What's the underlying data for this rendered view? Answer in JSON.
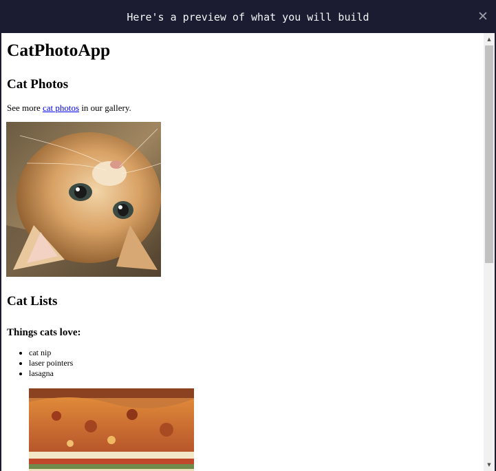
{
  "modal": {
    "title": "Here's a preview of what you will build",
    "close_icon": "close-icon"
  },
  "preview": {
    "app_title": "CatPhotoApp",
    "section1_heading": "Cat Photos",
    "intro_before": "See more ",
    "intro_link": "cat photos",
    "intro_after": " in our gallery.",
    "kitten_image": "relaxing-cat-image",
    "section2_heading": "Cat Lists",
    "list_heading": "Things cats love:",
    "list_items": [
      "cat nip",
      "laser pointers",
      "lasagna"
    ],
    "lasagna_image": "lasagna-image"
  },
  "scrollbar": {
    "up_icon": "scroll-up-arrow-icon",
    "down_icon": "scroll-down-arrow-icon"
  }
}
